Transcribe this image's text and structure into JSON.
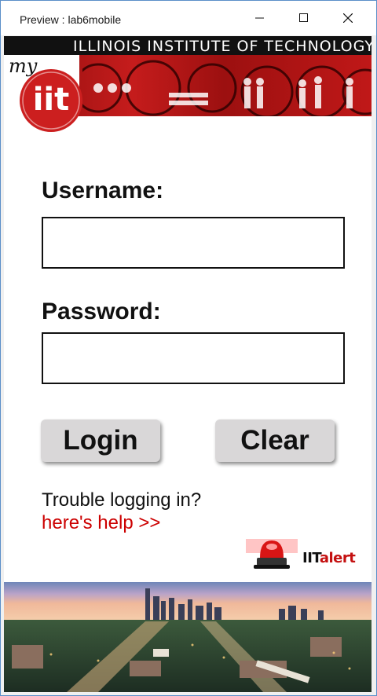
{
  "window": {
    "title": "Preview : lab6mobile",
    "minimize_icon": "minimize-icon",
    "maximize_icon": "maximize-icon",
    "close_icon": "close-icon"
  },
  "header": {
    "banner_title": "ILLINOIS INSTITUTE OF TECHNOLOGY",
    "logo_script": "my",
    "logo_mark": "iit",
    "brand_color": "#cc1f1f"
  },
  "form": {
    "username_label": "Username:",
    "username_value": "",
    "password_label": "Password:",
    "password_value": "",
    "login_label": "Login",
    "clear_label": "Clear"
  },
  "help": {
    "trouble_text": "Trouble logging in?",
    "help_link": "here's help >>",
    "link_color": "#cc0000"
  },
  "alert": {
    "prefix": "IIT",
    "suffix": "alert",
    "icon": "siren-icon"
  },
  "footer": {
    "image": "chicago-skyline-photo"
  }
}
